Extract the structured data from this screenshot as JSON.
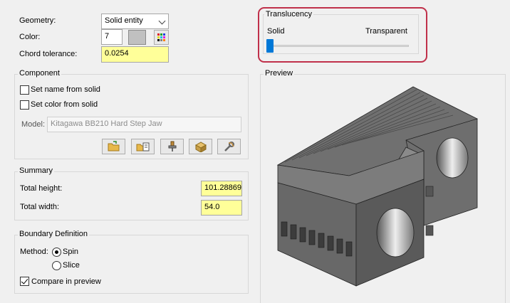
{
  "geometry": {
    "label": "Geometry:",
    "value": "Solid entity"
  },
  "color": {
    "label": "Color:",
    "index": "7",
    "swatch": "#c0c0c0"
  },
  "chord": {
    "label": "Chord tolerance:",
    "value": "0.0254"
  },
  "translucency": {
    "title": "Translucency",
    "left_label": "Solid",
    "right_label": "Transparent",
    "value_fraction": 0.0,
    "highlight_color": "#c0304a"
  },
  "component": {
    "title": "Component",
    "set_name_label": "Set name from solid",
    "set_name_checked": false,
    "set_color_label": "Set color from solid",
    "set_color_checked": false,
    "model_label": "Model:",
    "model_value": "Kitagawa BB210 Hard Step Jaw",
    "tool_buttons": [
      "open-folder-icon",
      "open-list-icon",
      "component-pin-icon",
      "export-box-icon",
      "tools-wrench-icon"
    ]
  },
  "summary": {
    "title": "Summary",
    "height_label": "Total height:",
    "height_value": "101.28869",
    "width_label": "Total width:",
    "width_value": "54.0"
  },
  "boundary": {
    "title": "Boundary Definition",
    "method_label": "Method:",
    "spin_label": "Spin",
    "slice_label": "Slice",
    "selected": "Spin",
    "compare_label": "Compare in preview",
    "compare_checked": true
  },
  "preview": {
    "title": "Preview",
    "solid_color": "#6a6a6a"
  },
  "colors": {
    "input_highlight": "#ffff99",
    "background": "#f0f0f0"
  }
}
